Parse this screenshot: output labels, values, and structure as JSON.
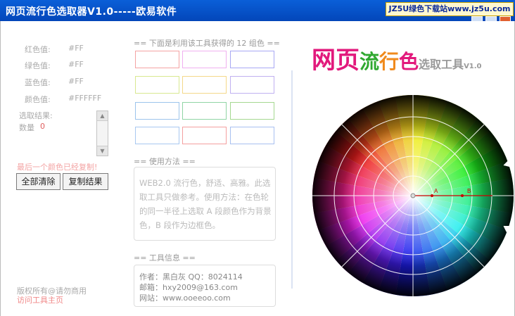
{
  "window": {
    "title": "网页流行色选取器V1.0-----欧易软件",
    "badge": "JZ5U绿色下载站www.jz5u.com"
  },
  "values": {
    "red_label": "红色值:",
    "red_value": "#FF",
    "green_label": "绿色值:",
    "green_value": "#FF",
    "blue_label": "蓝色值:",
    "blue_value": "#FF",
    "color_label": "颜色值:",
    "color_value": "#FFFFFF"
  },
  "result": {
    "label": "选取结果:",
    "count_label": "数量",
    "count_value": "0",
    "status": "最后一个颜色已经复制!"
  },
  "buttons": {
    "clear": "全部清除",
    "copy": "复制结果"
  },
  "swatches": {
    "title": "== 下面是利用该工具获得的 12 组色 ==",
    "borders": [
      "#f4a3a3",
      "#f0b0f0",
      "#a8a8f4",
      "#d8e890",
      "#f4d88a",
      "#c0b0f0",
      "#9cc4ec",
      "#90d4a4",
      "#a4d890",
      "#a8c8f0",
      "#f4a0a0",
      "#a8c0f0"
    ]
  },
  "usage": {
    "title": "== 使用方法 ==",
    "text": "WEB2.0 流行色，舒适、高雅。此选取工具只做参考。使用方法：在色轮的同一半径上选取 A 段颜色作为背景色，B 段作为边框色。"
  },
  "info": {
    "title": "== 工具信息 ==",
    "author": "作者：黑白灰 QQ：8024114",
    "email": "邮箱：hxy2009@163.com",
    "website": "网站：www.ooeeoo.com"
  },
  "footer": {
    "copyright": "版权所有@请勿商用",
    "homepage": "访问工具主页"
  },
  "logo": {
    "part1": "网页",
    "part2": "流",
    "part3": "行",
    "part4": "色",
    "part5": "选取工具",
    "version": "V1.0"
  },
  "wheel": {
    "marker_a": "A",
    "marker_b": "B"
  }
}
